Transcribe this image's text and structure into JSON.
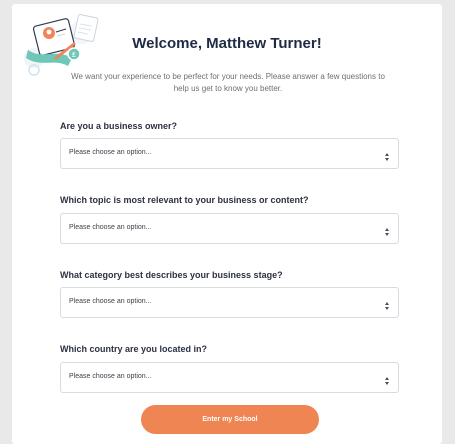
{
  "header": {
    "title": "Welcome, Matthew Turner!",
    "intro": "We want your experience to be perfect for your needs. Please answer a few questions to help us get to know you better."
  },
  "questions": [
    {
      "label": "Are you a business owner?",
      "placeholder": "Please choose an option..."
    },
    {
      "label": "Which topic is most relevant to your business or content?",
      "placeholder": "Please choose an option..."
    },
    {
      "label": "What category best describes your business stage?",
      "placeholder": "Please choose an option..."
    },
    {
      "label": "Which country are you located in?",
      "placeholder": "Please choose an option..."
    }
  ],
  "submit": {
    "label": "Enter my School"
  },
  "icons": {
    "illustration": "welcome-illustration-icon",
    "select_arrow": "select-arrows-icon"
  },
  "colors": {
    "page_background": "#e9e9ea",
    "card_background": "#ffffff",
    "title": "#1f2a44",
    "accent": "#ef8553",
    "illustration_teal": "#6fc7b8",
    "illustration_orange": "#f0855a"
  }
}
